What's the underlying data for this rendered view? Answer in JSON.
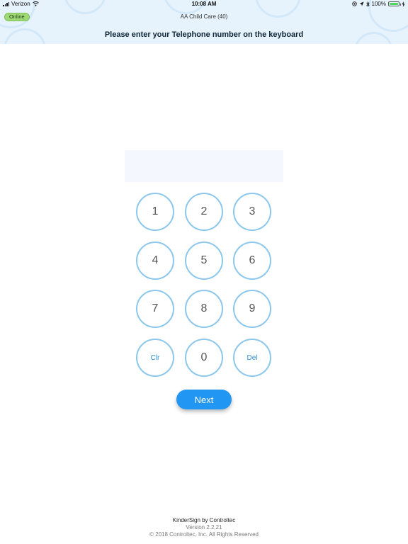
{
  "status_bar": {
    "carrier": "Verizon",
    "time": "10:08 AM",
    "battery": "100%",
    "battery_fraction": 1.0
  },
  "header": {
    "status_badge": "Online",
    "center_title": "AA Child Care (40)",
    "prompt": "Please enter your Telephone number on the keyboard"
  },
  "phone_display": {
    "value": ""
  },
  "keypad": {
    "keys": [
      "1",
      "2",
      "3",
      "4",
      "5",
      "6",
      "7",
      "8",
      "9",
      "Clr",
      "0",
      "Del"
    ]
  },
  "next_button": {
    "label": "Next"
  },
  "footer": {
    "brand": "KinderSign by Controltec",
    "version": "Version 2.2.21",
    "copyright": "© 2018 Controltec, Inc. All Rights Reserved"
  },
  "colors": {
    "header_bg": "#e6f3fc",
    "online_badge": "#9fd877",
    "key_border": "#8cc7ec",
    "function_key_text": "#2d8ed6",
    "next_button": "#2196f3"
  },
  "icons": [
    "signal-bars-icon",
    "wifi-icon",
    "location-icon",
    "navigation-arrow-icon",
    "bluetooth-icon",
    "battery-icon",
    "charging-icon"
  ]
}
